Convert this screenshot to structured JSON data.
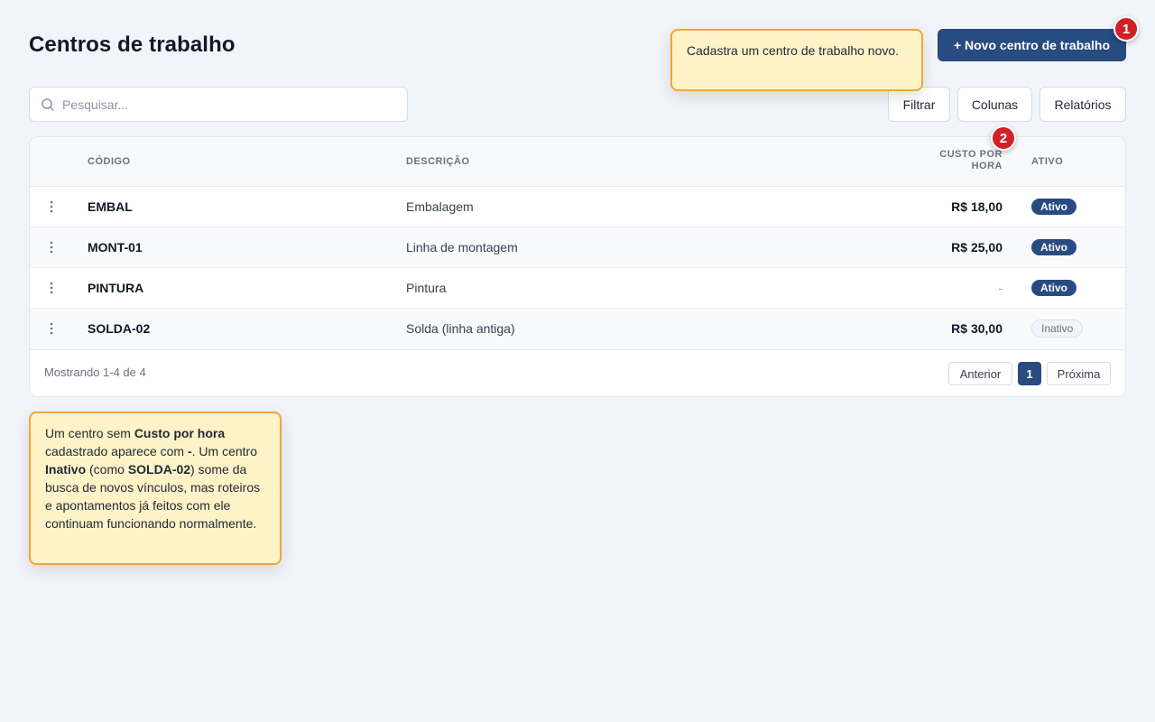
{
  "header": {
    "title": "Centros de trabalho",
    "new_button_label": "+ Novo centro de trabalho"
  },
  "markers": [
    "1",
    "2"
  ],
  "callouts": {
    "new_button": "Cadastra um centro de trabalho novo.",
    "note": {
      "t1": "Um centro sem ",
      "b1": "Custo por hora",
      "t2": " cadastrado aparece com ",
      "b2": "-",
      "t3": ". Um centro ",
      "b3": "Inativo",
      "t4": " (como ",
      "b4": "SOLDA-02",
      "t5": ") some da busca de novos vínculos, mas roteiros e apontamentos já feitos com ele continuam funcionando normalmente."
    }
  },
  "search": {
    "placeholder": "Pesquisar...",
    "value": ""
  },
  "toolbar": {
    "filter_label": "Filtrar",
    "columns_label": "Colunas",
    "reports_label": "Relatórios"
  },
  "table": {
    "columns": {
      "code": "CÓDIGO",
      "description": "DESCRIÇÃO",
      "cost": "CUSTO POR HORA",
      "active": "ATIVO"
    },
    "rows": [
      {
        "code": "EMBAL",
        "description": "Embalagem",
        "cost": "R$ 18,00",
        "status": "Ativo"
      },
      {
        "code": "MONT-01",
        "description": "Linha de montagem",
        "cost": "R$ 25,00",
        "status": "Ativo"
      },
      {
        "code": "PINTURA",
        "description": "Pintura",
        "cost": "-",
        "status": "Ativo"
      },
      {
        "code": "SOLDA-02",
        "description": "Solda (linha antiga)",
        "cost": "R$ 30,00",
        "status": "Inativo"
      }
    ]
  },
  "pagination": {
    "summary": "Mostrando 1-4 de 4",
    "previous_label": "Anterior",
    "current_page": "1",
    "next_label": "Próxima"
  },
  "colors": {
    "primary": "#284b80",
    "marker": "#d32027",
    "callout_background": "#fef3c7",
    "callout_border": "#f2a53a",
    "page_background": "#f1f4f8"
  }
}
